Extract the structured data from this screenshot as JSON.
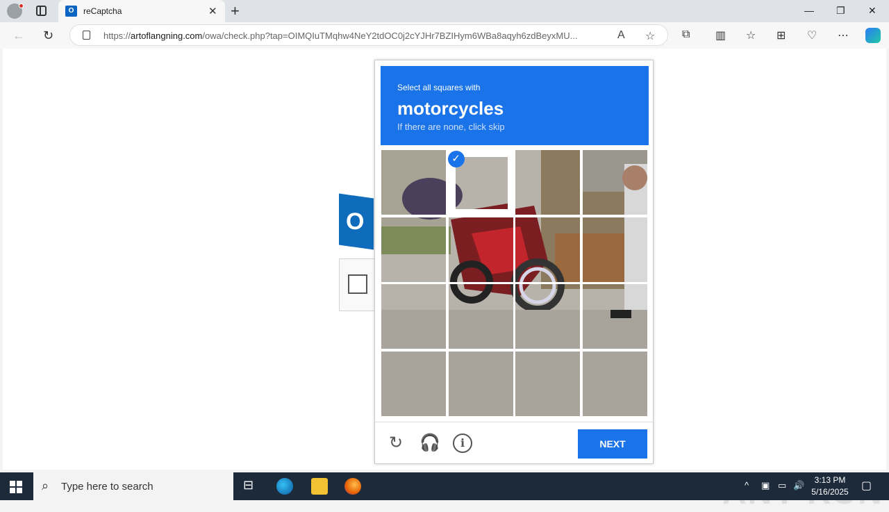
{
  "browser": {
    "tab_title": "reCaptcha",
    "tab_favicon": "O",
    "url_prefix": "https://",
    "url_domain": "artoflangning.com",
    "url_path": "/owa/check.php?tap=OIMQIuTMqhw4NeY2tdOC0j2cYJHr7BZIHym6WBa8aqyh6zdBeyxMU..."
  },
  "captcha": {
    "instruction_small": "Select all squares with",
    "instruction_target": "motorcycles",
    "instruction_sub": "If there are none, click skip",
    "next_label": "NEXT",
    "selected_tiles": [
      1
    ]
  },
  "page": {
    "outlook_letter": "O"
  },
  "watermark": "ANY RUN",
  "taskbar": {
    "search_placeholder": "Type here to search",
    "time": "3:13 PM",
    "date": "5/16/2025"
  }
}
